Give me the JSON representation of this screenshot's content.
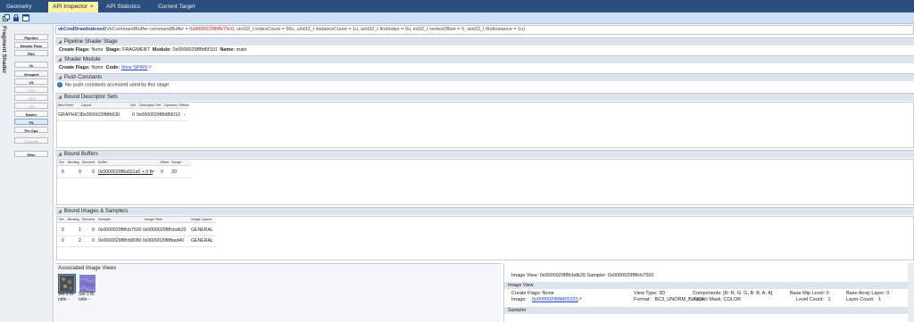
{
  "tabs": [
    {
      "label": "Geometry"
    },
    {
      "label": "API Inspector",
      "close": "×"
    },
    {
      "label": "API Statistics"
    },
    {
      "label": "Current Target"
    }
  ],
  "left_panel": {
    "title": "Fragment Shader",
    "stages": [
      "Pipeline",
      "Render Pass",
      "FBO",
      "IA",
      "Viewport",
      "VS",
      "TCS",
      "TES",
      "GS",
      "Raster",
      "FS",
      "Pix Ops",
      "Compute",
      "Misc"
    ]
  },
  "command": {
    "fn": "vkCmdDrawIndexed",
    "p1": "(VkCommandBuffer commandBuffer = ",
    "addr": "0x0000029f8ffe79c0",
    "p2": ", uint32_t indexCount = 96u, uint32_t instanceCount = 1u, uint32_t firstIndex = 0u, int32_t vertexOffset = 0, uint32_t firstInstance = 1u)"
  },
  "sections": {
    "pipeline_shader_stage": {
      "title": "Pipeline Shader Stage",
      "create_flags_label": "Create Flags:",
      "create_flags": "None",
      "stage_label": "Stage:",
      "stage": "FRAGMENT",
      "module_label": "Module:",
      "module": "0x0000029f8fd5f110",
      "name_label": "Name:",
      "name": "main"
    },
    "shader_module": {
      "title": "Shader Module",
      "create_flags_label": "Create Flags:",
      "create_flags": "None",
      "code_label": "Code:",
      "code_link": "View SPIRV"
    },
    "push_constants": {
      "title": "Push Constants",
      "message": "No push constants accessed used by this stage"
    },
    "descriptor_sets": {
      "title": "Bound Descriptor Sets",
      "headers": [
        "Bind Point",
        "Layout",
        "Set",
        "Descriptor Set",
        "Dynamic Offsets"
      ],
      "rows": [
        [
          "GRAPHICS",
          "0x0000029f8fb630",
          "0",
          "0x0000029f8fd89010",
          "-"
        ]
      ]
    },
    "bound_buffers": {
      "title": "Bound Buffers",
      "headers": [
        "Set",
        "Binding",
        "Element",
        "Buffer",
        "Offset",
        "Range"
      ],
      "rows": [
        [
          "0",
          "0",
          "0",
          "0x0000029f8a931a0 + 0 B",
          "0",
          "20"
        ]
      ]
    },
    "bound_images": {
      "title": "Bound Images & Samplers",
      "headers": [
        "Set",
        "Binding",
        "Element",
        "Sampler",
        "Image View",
        "Image Layout"
      ],
      "rows": [
        [
          "0",
          "1",
          "0",
          "0x0000029f8fcb7500",
          "0x0000029f8fcbdb20",
          "GENERAL"
        ],
        [
          "0",
          "2",
          "0",
          "0x0000029f8fcb8080",
          "0x0000029f8fbed40",
          "GENERAL"
        ]
      ]
    }
  },
  "associated_views": {
    "title": "Associated Image Views",
    "items": [
      {
        "label": "Set 0 Bi ndin···"
      },
      {
        "label": "Set 0 Bi ndin···"
      }
    ]
  },
  "detail": {
    "summary": "Image View: 0x0000029f8fcbdb20 Sampler: 0x0000029f8fcb7500",
    "image_view_header": "Image View",
    "create_flags_label": "Create Flags:",
    "create_flags": "None",
    "image_label": "Image:",
    "image_link": "0x0000029f8fd05320",
    "view_type_label": "View Type:",
    "view_type": "2D",
    "format_label": "Format:",
    "format": "BC3_UNORM_BLOCK",
    "components_label": "Components:",
    "components": "[R: R, G: G, B: B, A: A]",
    "aspect_label": "Aspect Mask:",
    "aspect": "COLOR",
    "base_mip_label": "Base Mip Level:",
    "base_mip": "0",
    "level_count_label": "Level Count:",
    "level_count": "1",
    "base_array_label": "Base Array Layer:",
    "base_array": "0",
    "layer_count_label": "Layer Count:",
    "layer_count": "1",
    "sampler_header": "Sampler"
  },
  "colors": {
    "tab_bar": "#2b4f7c",
    "active_tab": "#fdf3a5",
    "link": "#1d43c9",
    "section_header": "#dde4ed"
  }
}
